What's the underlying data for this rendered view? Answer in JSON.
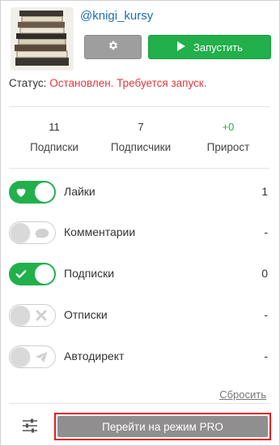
{
  "profile": {
    "username": "@knigi_kursy",
    "settings_icon": "gear-icon",
    "start_label": "Запустить",
    "start_icon": "play-icon"
  },
  "status": {
    "label": "Статус:",
    "value": "Остановлен. Требуется запуск."
  },
  "stats": [
    {
      "value": "11",
      "label": "Подписки"
    },
    {
      "value": "7",
      "label": "Подписчики"
    },
    {
      "value": "+0",
      "label": "Прирост"
    }
  ],
  "actions": [
    {
      "label": "Лайки",
      "count": "1",
      "enabled": true,
      "icon": "heart-icon"
    },
    {
      "label": "Комментарии",
      "count": "-",
      "enabled": false,
      "icon": "comment-icon"
    },
    {
      "label": "Подписки",
      "count": "0",
      "enabled": true,
      "icon": "check-icon"
    },
    {
      "label": "Отписки",
      "count": "-",
      "enabled": false,
      "icon": "close-icon"
    },
    {
      "label": "Автодирект",
      "count": "-",
      "enabled": false,
      "icon": "send-icon"
    }
  ],
  "footer": {
    "reset_label": "Сбросить",
    "pro_button_label": "Перейти на режим PRO",
    "filter_icon": "sliders-icon"
  },
  "colors": {
    "accent_green": "#21b04b",
    "status_red": "#e0393e",
    "link_blue": "#1a6fb3",
    "highlight_red": "#e51c1c"
  }
}
